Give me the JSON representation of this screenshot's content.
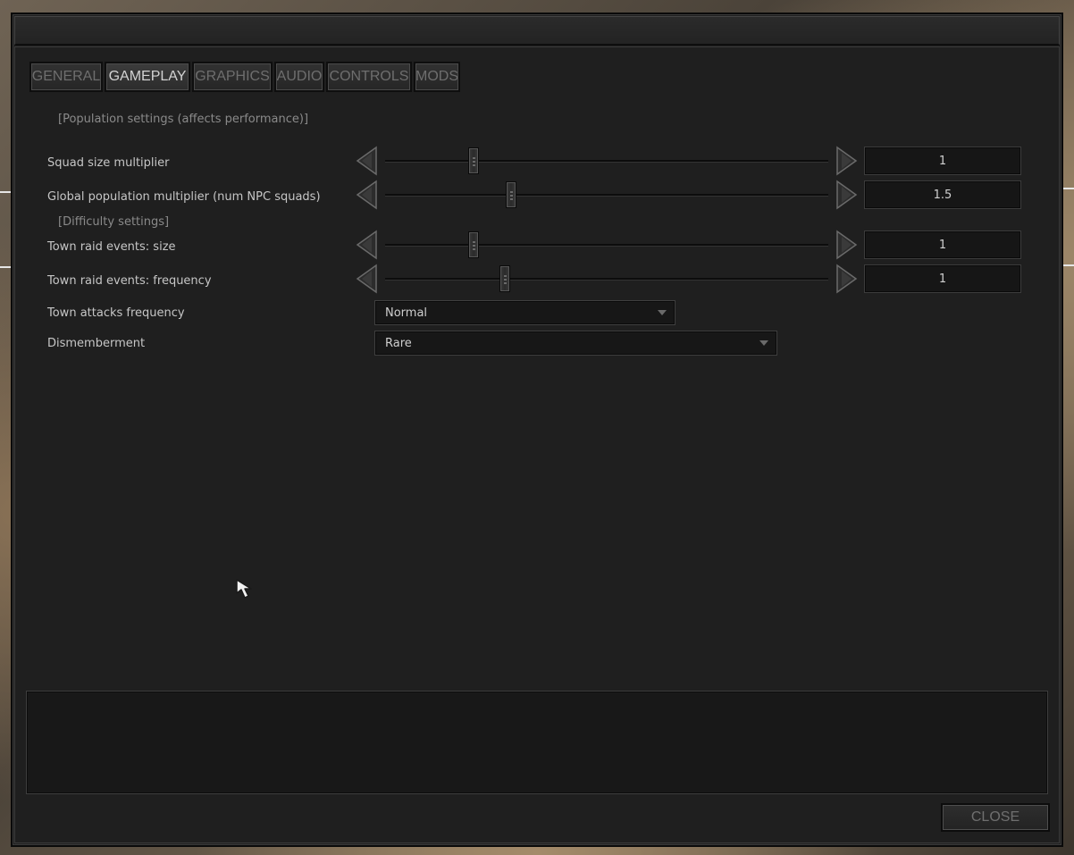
{
  "tabs": [
    "GENERAL",
    "GAMEPLAY",
    "GRAPHICS",
    "AUDIO",
    "CONTROLS",
    "MODS"
  ],
  "active_tab": "GAMEPLAY",
  "sections": {
    "population": "[Population settings (affects performance)]",
    "difficulty": "[Difficulty settings]"
  },
  "sliders": [
    {
      "label": "Squad size multiplier",
      "value": "1",
      "level": 0.2
    },
    {
      "label": "Global population multiplier (num NPC squads)",
      "value": "1.5",
      "level": 0.285
    },
    {
      "label": "Town raid events: size",
      "value": "1",
      "level": 0.2
    },
    {
      "label": "Town raid events: frequency",
      "value": "1",
      "level": 0.27
    }
  ],
  "dropdowns": [
    {
      "label": "Town attacks frequency",
      "value": "Normal"
    },
    {
      "label": "Dismemberment",
      "value": "Rare"
    }
  ],
  "close_label": "CLOSE",
  "colors": {
    "panel": "#1f1f1f",
    "active_tab_text": "#d2d2d2",
    "inactive_text": "#6e6e6e",
    "label_text": "#c6c6c6",
    "section_text": "#8a8a8a"
  }
}
